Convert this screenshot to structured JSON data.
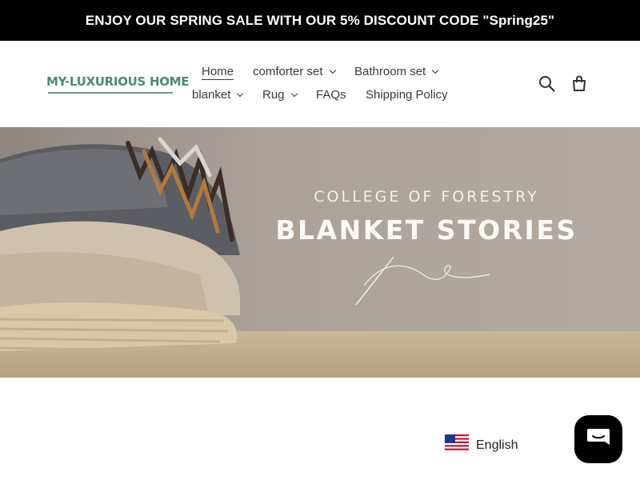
{
  "announcement": {
    "text": "ENJOY OUR SPRING SALE WITH OUR 5% DISCOUNT CODE \"Spring25\""
  },
  "logo": {
    "text": "MY-LUXURIOUS HOME"
  },
  "nav": {
    "items": [
      {
        "label": "Home",
        "active": true,
        "dropdown": false
      },
      {
        "label": "comforter set",
        "dropdown": true
      },
      {
        "label": "Bathroom set",
        "dropdown": true
      },
      {
        "label": "blanket",
        "dropdown": true
      },
      {
        "label": "Rug",
        "dropdown": true
      },
      {
        "label": "FAQs",
        "dropdown": false
      },
      {
        "label": "Shipping Policy",
        "dropdown": false
      }
    ]
  },
  "header_icons": [
    "search-icon",
    "cart-icon"
  ],
  "hero": {
    "subtitle": "COLLEGE OF FORESTRY",
    "title": "BLANKET STORIES"
  },
  "language": {
    "label": "English",
    "flag": "us-flag-icon"
  },
  "chat": {
    "icon": "chat-icon"
  },
  "colors": {
    "announcement_bg": "#000000",
    "logo": "#4a8a78",
    "text": "#3a3a3a",
    "chat_bg": "#000000"
  }
}
